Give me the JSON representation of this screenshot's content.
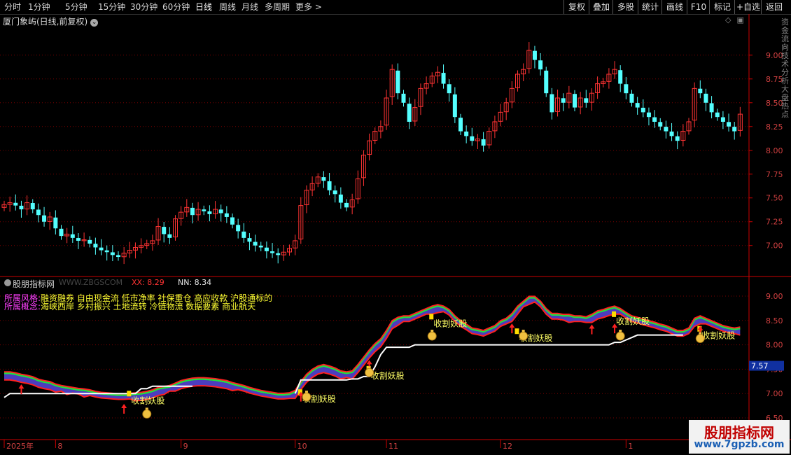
{
  "toolbar": {
    "periods": [
      "分时",
      "1分钟",
      "5分钟",
      "15分钟",
      "30分钟",
      "60分钟",
      "日线",
      "周线",
      "月线",
      "多周期",
      "更多 >"
    ],
    "active_period": "日线",
    "right_buttons": [
      "复权",
      "叠加",
      "多股",
      "统计",
      "画线",
      "F10",
      "标记",
      "+自选",
      "返回"
    ]
  },
  "stock": {
    "title": "厦门象屿(日线,前复权)",
    "dropdown_icon": "chevron-down-icon"
  },
  "sub": {
    "name": "股朋指标网",
    "watermark": "WWW.ZBGSCOM",
    "xx": "XX: 8.29",
    "nn": "NN: 8.34",
    "style_label": "所属风格:",
    "style_value": "融资融券 自由现金流 低市净率 社保重仓 高应收款 沪股通标的",
    "concept_label": "所属概念:",
    "concept_value": "海峡西岸 乡村振兴 土地流转 冷链物流 数据要素 商业航天",
    "price_tag": "7.57",
    "signal_label": "收割妖股"
  },
  "logo": {
    "line1": "股朋指标网",
    "line2": "www.7gpzb.com"
  },
  "side_text": "资金流向技术分析大盘热点",
  "colors": {
    "up": "#ff3333",
    "down": "#54ffff",
    "grid": "#7a0000",
    "axis": "#cc0000"
  },
  "chart_data": {
    "type": "candlestick",
    "title": "厦门象屿(日线,前复权)",
    "y_ticks": [
      7.0,
      7.25,
      7.5,
      7.75,
      8.0,
      8.25,
      8.5,
      8.75,
      9.0
    ],
    "y_range": [
      6.77,
      9.3
    ],
    "sub_y_ticks": [
      6.5,
      7.0,
      7.5,
      8.0,
      8.5,
      9.0
    ],
    "x_labels": [
      {
        "label": "2025年",
        "index": 0
      },
      {
        "label": "8",
        "index": 9
      },
      {
        "label": "9",
        "index": 31
      },
      {
        "label": "10",
        "index": 51
      },
      {
        "label": "11",
        "index": 67
      },
      {
        "label": "12",
        "index": 87
      },
      {
        "label": "1",
        "index": 109
      }
    ],
    "closes": [
      7.43,
      7.45,
      7.42,
      7.38,
      7.45,
      7.38,
      7.32,
      7.25,
      7.3,
      7.18,
      7.1,
      7.12,
      7.08,
      7.05,
      7.06,
      7.02,
      6.98,
      6.95,
      6.93,
      6.9,
      6.88,
      6.92,
      6.95,
      6.98,
      7.0,
      7.02,
      7.05,
      7.2,
      7.12,
      7.08,
      7.28,
      7.35,
      7.4,
      7.32,
      7.38,
      7.36,
      7.33,
      7.38,
      7.34,
      7.3,
      7.22,
      7.15,
      7.08,
      7.04,
      7.0,
      6.98,
      6.94,
      6.92,
      6.9,
      6.93,
      6.97,
      7.05,
      7.42,
      7.58,
      7.65,
      7.72,
      7.68,
      7.58,
      7.54,
      7.45,
      7.4,
      7.48,
      7.7,
      7.95,
      8.1,
      8.2,
      8.25,
      8.55,
      8.85,
      8.6,
      8.5,
      8.3,
      8.45,
      8.65,
      8.7,
      8.78,
      8.82,
      8.7,
      8.6,
      8.35,
      8.2,
      8.15,
      8.1,
      8.12,
      8.05,
      8.2,
      8.3,
      8.4,
      8.5,
      8.65,
      8.8,
      8.85,
      9.05,
      8.95,
      8.85,
      8.6,
      8.4,
      8.55,
      8.5,
      8.6,
      8.45,
      8.55,
      8.5,
      8.6,
      8.7,
      8.72,
      8.8,
      8.85,
      8.7,
      8.6,
      8.5,
      8.45,
      8.4,
      8.35,
      8.3,
      8.25,
      8.2,
      8.15,
      8.1,
      8.2,
      8.3,
      8.65,
      8.6,
      8.5,
      8.4,
      8.35,
      8.3,
      8.25,
      8.2,
      8.38
    ],
    "xx_line": [
      7.4,
      7.4,
      7.38,
      7.35,
      7.33,
      7.3,
      7.25,
      7.22,
      7.2,
      7.15,
      7.12,
      7.1,
      7.08,
      7.06,
      7.05,
      7.03,
      7.0,
      6.98,
      6.97,
      6.96,
      6.95,
      6.95,
      6.96,
      6.97,
      6.98,
      7.0,
      7.03,
      7.08,
      7.1,
      7.12,
      7.17,
      7.22,
      7.25,
      7.27,
      7.28,
      7.28,
      7.27,
      7.26,
      7.24,
      7.22,
      7.18,
      7.15,
      7.12,
      7.08,
      7.05,
      7.02,
      7.0,
      6.98,
      6.96,
      6.96,
      6.97,
      7.02,
      7.2,
      7.35,
      7.45,
      7.52,
      7.55,
      7.52,
      7.48,
      7.42,
      7.4,
      7.42,
      7.55,
      7.7,
      7.85,
      7.98,
      8.08,
      8.25,
      8.45,
      8.52,
      8.55,
      8.55,
      8.6,
      8.65,
      8.7,
      8.75,
      8.78,
      8.75,
      8.68,
      8.55,
      8.45,
      8.38,
      8.3,
      8.28,
      8.25,
      8.3,
      8.35,
      8.45,
      8.5,
      8.6,
      8.75,
      8.85,
      8.95,
      8.95,
      8.85,
      8.7,
      8.6,
      8.6,
      8.58,
      8.58,
      8.55,
      8.55,
      8.53,
      8.58,
      8.65,
      8.68,
      8.72,
      8.75,
      8.7,
      8.62,
      8.55,
      8.52,
      8.48,
      8.45,
      8.42,
      8.38,
      8.35,
      8.3,
      8.25,
      8.25,
      8.3,
      8.5,
      8.55,
      8.5,
      8.45,
      8.4,
      8.35,
      8.32,
      8.3,
      8.32
    ],
    "white_line": [
      6.92,
      7.0,
      7.0,
      7.0,
      7.0,
      7.0,
      7.0,
      7.0,
      7.0,
      7.0,
      7.0,
      7.0,
      7.0,
      7.0,
      7.0,
      7.0,
      7.0,
      7.0,
      7.0,
      7.0,
      7.0,
      7.0,
      7.0,
      7.0,
      7.1,
      7.1,
      7.15,
      7.15,
      7.15,
      7.15,
      7.15,
      7.15,
      7.15,
      7.15,
      null,
      null,
      null,
      null,
      null,
      null,
      null,
      null,
      null,
      null,
      null,
      null,
      null,
      null,
      null,
      null,
      null,
      7.0,
      7.28,
      7.28,
      7.28,
      7.28,
      7.28,
      7.28,
      7.28,
      7.28,
      7.28,
      7.3,
      7.3,
      7.35,
      7.35,
      7.55,
      7.8,
      7.95,
      7.95,
      7.95,
      7.95,
      7.95,
      8.0,
      8.0,
      8.0,
      8.0,
      8.0,
      8.0,
      8.0,
      8.0,
      8.0,
      8.0,
      8.0,
      8.0,
      8.0,
      8.0,
      8.0,
      8.0,
      8.0,
      8.0,
      8.0,
      8.0,
      8.0,
      8.0,
      8.0,
      8.0,
      8.0,
      8.0,
      8.0,
      8.0,
      8.0,
      8.0,
      8.0,
      8.0,
      8.0,
      8.0,
      8.0,
      8.05,
      8.05,
      8.1,
      8.15,
      8.2,
      8.2,
      8.2,
      8.2,
      8.2,
      8.2,
      8.2,
      8.2,
      8.2,
      null,
      null,
      null,
      null,
      null,
      null,
      null,
      null,
      null,
      null
    ],
    "signals": [
      {
        "index": 22,
        "price": 6.97
      },
      {
        "index": 52,
        "price": 7.0
      },
      {
        "index": 64,
        "price": 7.48
      },
      {
        "index": 75,
        "price": 8.55
      },
      {
        "index": 90,
        "price": 8.25
      },
      {
        "index": 107,
        "price": 8.6
      },
      {
        "index": 122,
        "price": 8.3
      }
    ],
    "arrows": [
      3,
      21,
      52,
      64,
      89,
      103,
      107,
      122
    ],
    "money_bags": [
      25,
      53,
      64,
      75,
      91,
      108,
      122
    ]
  }
}
